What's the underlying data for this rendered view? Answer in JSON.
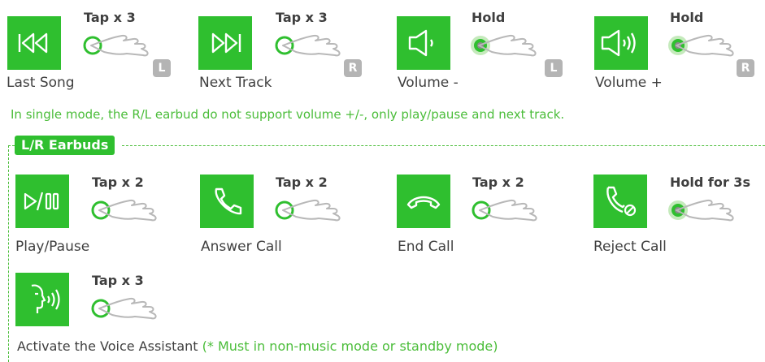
{
  "colors": {
    "accent": "#2fbf2f",
    "note": "#4bbd3a",
    "badge": "#b4b4b4"
  },
  "single_mode": [
    {
      "icon": "previous-track-icon",
      "gesture": "Tap x 3",
      "badge": "L",
      "label": "Last Song"
    },
    {
      "icon": "next-track-icon",
      "gesture": "Tap x 3",
      "badge": "R",
      "label": "Next Track"
    },
    {
      "icon": "volume-down-icon",
      "gesture": "Hold",
      "badge": "L",
      "label": "Volume -"
    },
    {
      "icon": "volume-up-icon",
      "gesture": "Hold",
      "badge": "R",
      "label": "Volume +"
    }
  ],
  "note": "In single mode, the R/L earbud do not support volume +/-, only play/pause and next track.",
  "section": {
    "title": "L/R Earbuds",
    "items": [
      {
        "icon": "play-pause-icon",
        "gesture": "Tap x 2",
        "label": "Play/Pause"
      },
      {
        "icon": "answer-call-icon",
        "gesture": "Tap x 2",
        "label": "Answer Call"
      },
      {
        "icon": "end-call-icon",
        "gesture": "Tap x 2",
        "label": "End Call"
      },
      {
        "icon": "reject-call-icon",
        "gesture": "Hold for 3s",
        "label": "Reject Call"
      }
    ],
    "voice": {
      "icon": "voice-assistant-icon",
      "gesture": "Tap x 3",
      "label": "Activate the Voice Assistant",
      "note": "(* Must in non-music mode or standby mode)"
    }
  }
}
